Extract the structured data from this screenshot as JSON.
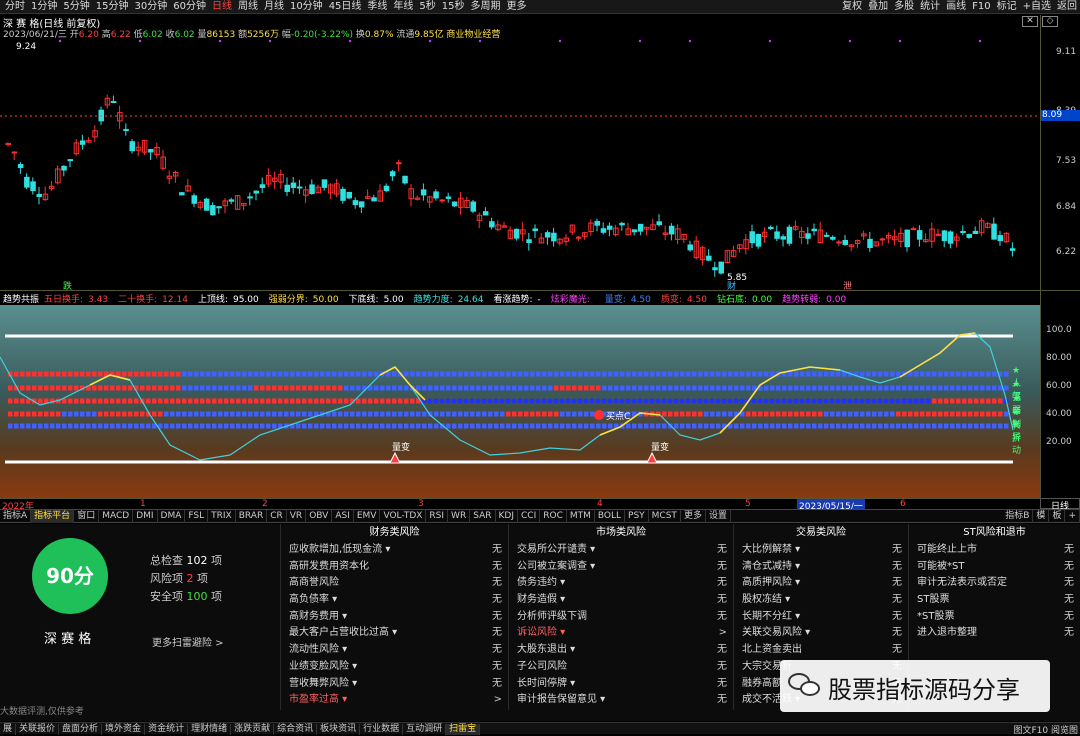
{
  "top": {
    "periods": [
      "分时",
      "1分钟",
      "5分钟",
      "15分钟",
      "30分钟",
      "60分钟",
      "日线",
      "周线",
      "月线",
      "10分钟",
      "45日线",
      "季线",
      "年线",
      "5秒",
      "15秒",
      "多周期",
      "更多"
    ],
    "tools": [
      "复权",
      "叠加",
      "多股",
      "统计",
      "画线",
      "F10",
      "标记",
      "+自选",
      "返回"
    ]
  },
  "chart": {
    "title": "深 赛 格(日线 前复权)",
    "date": "2023/06/21/三",
    "open_l": "开",
    "open": "6.20",
    "high_l": "高",
    "high": "6.22",
    "low_l": "低",
    "low": "6.02",
    "close_l": "收",
    "close": "6.02",
    "vol_l": "量",
    "vol": "86153",
    "amt_l": "额",
    "amt": "5256万",
    "chg_l": "幅",
    "chg": "-0.20(-3.22%)",
    "turn_l": "换",
    "turn": "0.87%",
    "float_l": "流通",
    "float": "9.85亿",
    "industry": "商业物业经营",
    "hi_mark": "9.24",
    "lo_mark": "5.85",
    "price_labels": [
      "9.11",
      "8.39",
      "7.53",
      "6.84",
      "6.22"
    ],
    "current_price": "8.09",
    "tag_die": "跌",
    "tag_cai": "财",
    "tag_xie": "泄"
  },
  "ind": {
    "name": "趋势共振",
    "items": [
      {
        "t": "五日换手:",
        "v": "3.43",
        "c": "#ff4040"
      },
      {
        "t": "二十换手:",
        "v": "12.14",
        "c": "#ff4040"
      },
      {
        "t": "上顶线:",
        "v": "95.00",
        "c": "#ffffff"
      },
      {
        "t": "强弱分界:",
        "v": "50.00",
        "c": "#ffe040"
      },
      {
        "t": "下底线:",
        "v": "5.00",
        "c": "#ffffff"
      },
      {
        "t": "趋势力度:",
        "v": "24.64",
        "c": "#40e0e0"
      },
      {
        "t": "看涨趋势:",
        "v": "-",
        "c": "#ffffff"
      },
      {
        "t": "炫彩魔光:",
        "v": "",
        "c": "#ff40ff"
      },
      {
        "t": "量变:",
        "v": "4.50",
        "c": "#4080ff"
      },
      {
        "t": "质变:",
        "v": "4.50",
        "c": "#ff4040"
      },
      {
        "t": "钻石底:",
        "v": "0.00",
        "c": "#40ff40"
      },
      {
        "t": "趋势转弱:",
        "v": "0.00",
        "c": "#ff40ff"
      }
    ],
    "ticks": [
      "100.0",
      "80.00",
      "60.00",
      "40.00",
      "20.00"
    ],
    "side_labels": [
      "★人气",
      "★强弱",
      "★牵制",
      "★转折",
      "★异动"
    ],
    "markers": [
      "量变",
      "买点C",
      "量变"
    ],
    "xlabels": [
      "2022年",
      "1",
      "2",
      "3",
      "4",
      "5",
      "6"
    ],
    "date_box": "2023/05/15/一",
    "right_btn": "日线"
  },
  "tabs": [
    "指标A",
    "指标平台",
    "窗口",
    "MACD",
    "DMI",
    "DMA",
    "FSL",
    "TRIX",
    "BRAR",
    "CR",
    "VR",
    "OBV",
    "ASI",
    "EMV",
    "VOL-TDX",
    "RSI",
    "WR",
    "SAR",
    "KDJ",
    "CCI",
    "ROC",
    "MTM",
    "BOLL",
    "PSY",
    "MCST",
    "更多",
    "设置"
  ],
  "tabs_right": [
    "指标B",
    "模",
    "板",
    "+"
  ],
  "score": {
    "value": "90分",
    "name": "深 赛 格",
    "total_l": "总检查",
    "total": "102",
    "total_u": "项",
    "risk_l": "风险项",
    "risk": "2",
    "risk_u": "项",
    "safe_l": "安全项",
    "safe": "100",
    "safe_u": "项",
    "more": "更多扫雷避险 >",
    "source": "基于大数据评测,仅供参考"
  },
  "cols": [
    {
      "title": "财务类风险",
      "rows": [
        {
          "t": "应收款增加,低现金流 ▾",
          "v": "无"
        },
        {
          "t": "高研发费用资本化",
          "v": "无"
        },
        {
          "t": "高商誉风险",
          "v": "无"
        },
        {
          "t": "高负债率 ▾",
          "v": "无"
        },
        {
          "t": "高财务费用 ▾",
          "v": "无"
        },
        {
          "t": "最大客户占营收比过高 ▾",
          "v": "无"
        },
        {
          "t": "流动性风险 ▾",
          "v": "无"
        },
        {
          "t": "业绩变脸风险 ▾",
          "v": "无"
        },
        {
          "t": "营收舞弊风险 ▾",
          "v": "无"
        },
        {
          "t": "市盈率过高 ▾",
          "v": ">",
          "red": true
        }
      ]
    },
    {
      "title": "市场类风险",
      "rows": [
        {
          "t": "交易所公开谴责 ▾",
          "v": "无"
        },
        {
          "t": "公司被立案调查 ▾",
          "v": "无"
        },
        {
          "t": "债务违约 ▾",
          "v": "无"
        },
        {
          "t": "财务造假 ▾",
          "v": "无"
        },
        {
          "t": "分析师评级下调",
          "v": "无"
        },
        {
          "t": "诉讼风险 ▾",
          "v": ">",
          "red": true
        },
        {
          "t": "大股东退出 ▾",
          "v": "无"
        },
        {
          "t": "子公司风险",
          "v": "无"
        },
        {
          "t": "长时间停牌 ▾",
          "v": "无"
        },
        {
          "t": "审计报告保留意见 ▾",
          "v": "无"
        }
      ]
    },
    {
      "title": "交易类风险",
      "rows": [
        {
          "t": "大比例解禁 ▾",
          "v": "无"
        },
        {
          "t": "清仓式减持 ▾",
          "v": "无"
        },
        {
          "t": "高质押风险 ▾",
          "v": "无"
        },
        {
          "t": "股权冻结 ▾",
          "v": "无"
        },
        {
          "t": "长期不分红 ▾",
          "v": "无"
        },
        {
          "t": "关联交易风险 ▾",
          "v": "无"
        },
        {
          "t": "北上资金卖出",
          "v": "无"
        },
        {
          "t": "大宗交易折",
          "v": "无"
        },
        {
          "t": "融券高额",
          "v": "无"
        },
        {
          "t": "成交不活跃 ▾",
          "v": "无"
        }
      ]
    },
    {
      "title": "ST风险和退市",
      "rows": [
        {
          "t": "可能终止上市",
          "v": "无"
        },
        {
          "t": "可能被*ST",
          "v": "无"
        },
        {
          "t": "审计无法表示或否定",
          "v": "无"
        },
        {
          "t": "ST股票",
          "v": "无"
        },
        {
          "t": "*ST股票",
          "v": "无"
        },
        {
          "t": "进入退市整理",
          "v": "无"
        }
      ]
    }
  ],
  "watermark": "股票指标源码分享",
  "footer": [
    "展",
    "关联报价",
    "盘面分析",
    "境外资金",
    "资金统计",
    "理财情绪",
    "涨跌贡献",
    "综合资讯",
    "板块资讯",
    "行业数据",
    "互动调研",
    "扫雷宝"
  ],
  "footer_right": "图文F10 阅览图",
  "colors": {
    "up": "#ff3030",
    "down": "#30e0e0",
    "accent": "#ffe040",
    "score_green": "#1fbf5a"
  }
}
